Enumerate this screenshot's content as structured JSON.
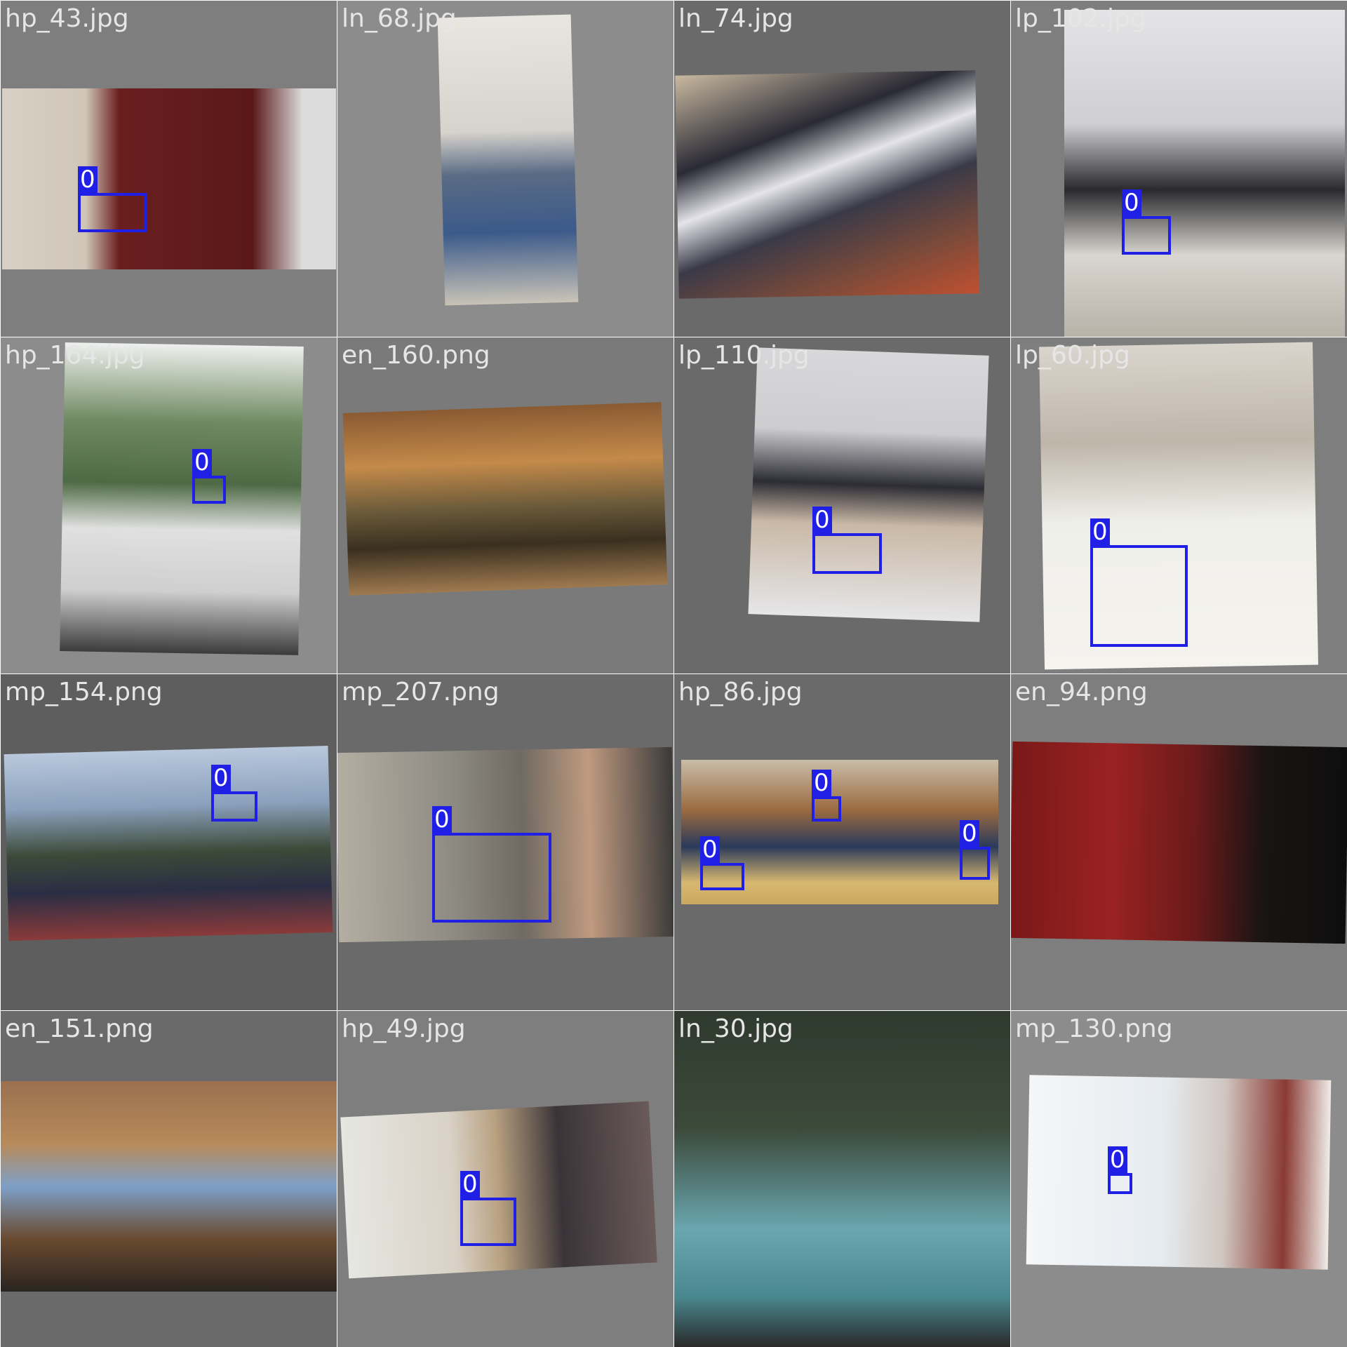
{
  "app": {
    "box_color": "#1f1fe6",
    "tile_label_color": "#e6e6e6"
  },
  "tiles": [
    {
      "name": "hp_43.jpg",
      "background": "#7e7e7e",
      "photo_tone": "warm-curtain-room",
      "boxes": [
        {
          "label": "0"
        }
      ]
    },
    {
      "name": "ln_68.jpg",
      "background": "#8c8c8c",
      "photo_tone": "blue-hoodie-chair",
      "boxes": []
    },
    {
      "name": "ln_74.jpg",
      "background": "#6a6a6a",
      "photo_tone": "bed-two-people",
      "boxes": []
    },
    {
      "name": "lp_102.jpg",
      "background": "#7e7e7e",
      "photo_tone": "bed-laptop",
      "boxes": [
        {
          "label": "0"
        }
      ]
    },
    {
      "name": "hp_164.jpg",
      "background": "#8c8c8c",
      "photo_tone": "street-motorbike",
      "boxes": [
        {
          "label": "0"
        }
      ]
    },
    {
      "name": "en_160.png",
      "background": "#7a7a7a",
      "photo_tone": "park-bench",
      "boxes": []
    },
    {
      "name": "lp_110.jpg",
      "background": "#6a6a6a",
      "photo_tone": "laptop-phone",
      "boxes": [
        {
          "label": "0"
        }
      ]
    },
    {
      "name": "lp_60.jpg",
      "background": "#7e7e7e",
      "photo_tone": "white-tshirt-phone",
      "boxes": [
        {
          "label": "0"
        }
      ]
    },
    {
      "name": "mp_154.png",
      "background": "#5e5e5e",
      "photo_tone": "selfie-outdoor",
      "boxes": [
        {
          "label": "0"
        }
      ]
    },
    {
      "name": "mp_207.png",
      "background": "#6a6a6a",
      "photo_tone": "mirror-selfie",
      "boxes": [
        {
          "label": "0"
        }
      ]
    },
    {
      "name": "hp_86.jpg",
      "background": "#6a6a6a",
      "photo_tone": "classroom-three",
      "boxes": [
        {
          "label": "0"
        },
        {
          "label": "0"
        },
        {
          "label": "0"
        }
      ]
    },
    {
      "name": "en_94.png",
      "background": "#7e7e7e",
      "photo_tone": "stage-red-curtain",
      "boxes": []
    },
    {
      "name": "en_151.png",
      "background": "#6a6a6a",
      "photo_tone": "cafe-writing",
      "boxes": []
    },
    {
      "name": "hp_49.jpg",
      "background": "#7e7e7e",
      "photo_tone": "classroom-phone",
      "boxes": [
        {
          "label": "0"
        }
      ]
    },
    {
      "name": "ln_30.jpg",
      "background": "#3f4a3c",
      "photo_tone": "cricket-field",
      "boxes": []
    },
    {
      "name": "mp_130.png",
      "background": "#8c8c8c",
      "photo_tone": "window-call",
      "boxes": [
        {
          "label": "0"
        }
      ]
    }
  ]
}
